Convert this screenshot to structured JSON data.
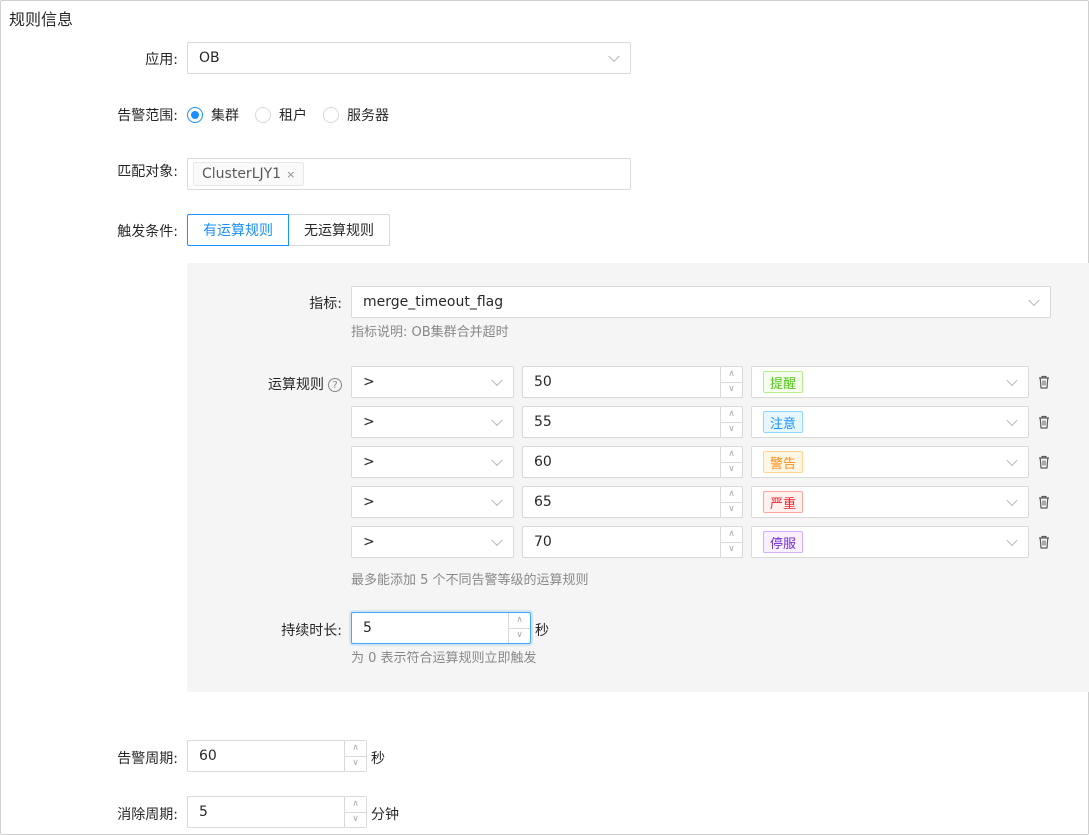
{
  "section_title": "规则信息",
  "app": {
    "label": "应用:",
    "value": "OB"
  },
  "scope": {
    "label": "告警范围:",
    "options": [
      "集群",
      "租户",
      "服务器"
    ],
    "selected": "集群"
  },
  "target": {
    "label": "匹配对象:",
    "tags": [
      "ClusterLJY1"
    ],
    "tag_close": "×"
  },
  "trigger": {
    "label": "触发条件:",
    "options": [
      "有运算规则",
      "无运算规则"
    ],
    "selected": "有运算规则"
  },
  "metric": {
    "label": "指标:",
    "value": "merge_timeout_flag",
    "help": "指标说明: OB集群合并超时"
  },
  "rules": {
    "label": "运算规则",
    "help_icon": "question-circle-icon",
    "rows": [
      {
        "operator": ">",
        "value": "50",
        "level": "提醒",
        "level_color": "#52c41a",
        "level_bg": "#f6ffed",
        "level_border": "#b7eb8f"
      },
      {
        "operator": ">",
        "value": "55",
        "level": "注意",
        "level_color": "#1890ff",
        "level_bg": "#e6f7ff",
        "level_border": "#91d5ff"
      },
      {
        "operator": ">",
        "value": "60",
        "level": "警告",
        "level_color": "#fa8c16",
        "level_bg": "#fff7e6",
        "level_border": "#ffd591"
      },
      {
        "operator": ">",
        "value": "65",
        "level": "严重",
        "level_color": "#f5222d",
        "level_bg": "#fff1f0",
        "level_border": "#ffa39e"
      },
      {
        "operator": ">",
        "value": "70",
        "level": "停服",
        "level_color": "#722ed1",
        "level_bg": "#f9f0ff",
        "level_border": "#d3adf7"
      }
    ],
    "limit_help": "最多能添加 5 个不同告警等级的运算规则"
  },
  "duration": {
    "label": "持续时长:",
    "value": "5",
    "unit": "秒",
    "help": "为 0 表示符合运算规则立即触发"
  },
  "alert_period": {
    "label": "告警周期:",
    "value": "60",
    "unit": "秒"
  },
  "clear_period": {
    "label": "消除周期:",
    "value": "5",
    "unit": "分钟"
  },
  "colors": {
    "primary": "#1890ff",
    "panel_bg": "#f5f5f5",
    "border": "#d9d9d9"
  }
}
